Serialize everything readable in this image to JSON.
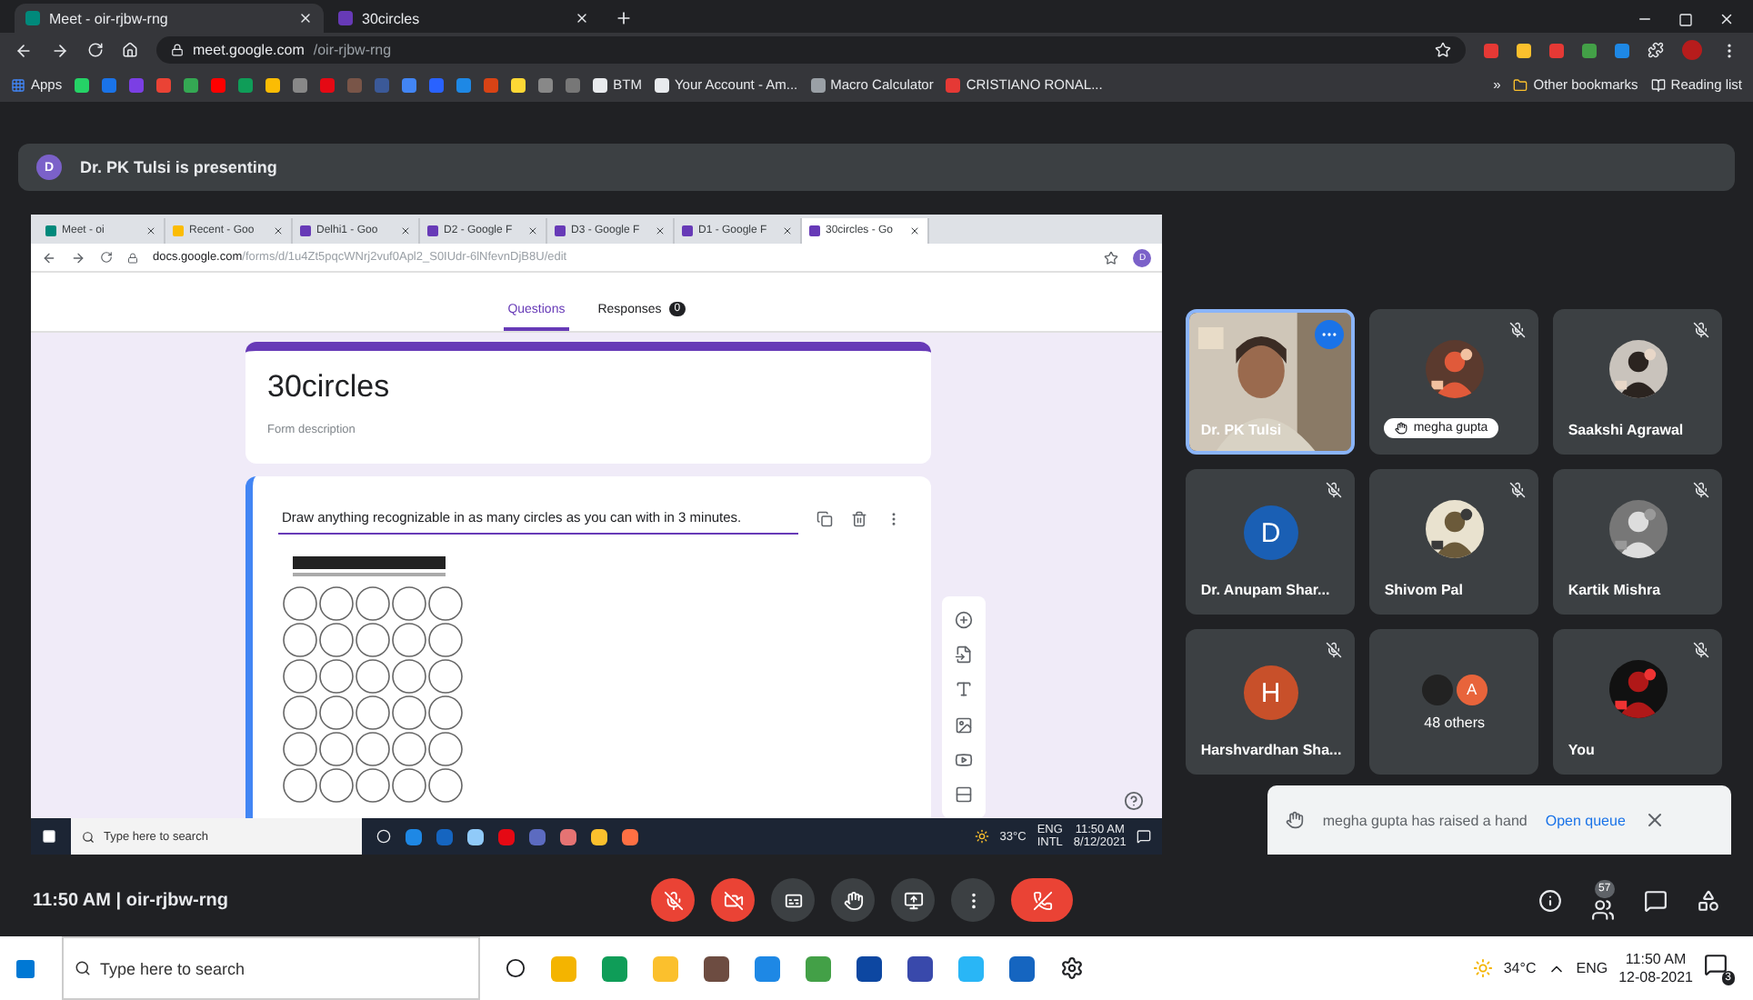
{
  "browser": {
    "tabs": [
      {
        "label": "Meet - oir-rjbw-rng",
        "selected": true
      },
      {
        "label": "30circles",
        "selected": false
      }
    ],
    "url_host": "meet.google.com",
    "url_path": "/oir-rjbw-rng",
    "apps": "Apps",
    "bookmarks": [
      "BTM",
      "Your Account - Am...",
      "Macro Calculator",
      "CRISTIANO RONAL..."
    ],
    "overflow": "»",
    "other_bookmarks": "Other bookmarks",
    "reading_list": "Reading list"
  },
  "presenting": {
    "avatar": "D",
    "text": "Dr. PK Tulsi is presenting"
  },
  "shared_screen": {
    "tabs": [
      {
        "label": "Meet - oi",
        "selected": false
      },
      {
        "label": "Recent - Goo",
        "selected": false
      },
      {
        "label": "Delhi1 - Goo",
        "selected": false
      },
      {
        "label": "D2 - Google F",
        "selected": false
      },
      {
        "label": "D3 - Google F",
        "selected": false
      },
      {
        "label": "D1 - Google F",
        "selected": false
      },
      {
        "label": "30circles - Go",
        "selected": true
      }
    ],
    "url_host": "docs.google.com",
    "url_path": "/forms/d/1u4Zt5pqcWNrj2vuf0Apl2_S0IUdr-6lNfevnDjB8U/edit",
    "profile": "D",
    "form_tabs": [
      {
        "label": "Questions",
        "selected": true
      },
      {
        "label": "Responses",
        "selected": false,
        "count": "0"
      }
    ],
    "form_title": "30circles",
    "form_description": "Form description",
    "question": "Draw anything recognizable in as many circles as you can with in 3 minutes.",
    "taskbar": {
      "search": "Type here to search",
      "temperature": "33°C",
      "lang": "ENG",
      "layout": "INTL",
      "time": "11:50 AM",
      "date": "8/12/2021"
    }
  },
  "participants": [
    {
      "name": "Dr. PK Tulsi",
      "kind": "video",
      "muted": false,
      "speaking": true,
      "hand_raised": false
    },
    {
      "name": "megha gupta",
      "muted": true,
      "speaking": false,
      "hand_raised": true
    },
    {
      "name": "Saakshi Agrawal",
      "muted": true,
      "speaking": false,
      "hand_raised": false
    },
    {
      "name": "Dr. Anupam Shar...",
      "kind": "letter",
      "letter": "D",
      "color": "#1a5fb4",
      "muted": true,
      "speaking": false,
      "hand_raised": false
    },
    {
      "name": "Shivom Pal",
      "muted": true,
      "speaking": false,
      "hand_raised": false
    },
    {
      "name": "Kartik Mishra",
      "muted": true,
      "speaking": false,
      "hand_raised": false
    },
    {
      "name": "Harshvardhan Sha...",
      "kind": "letter",
      "letter": "H",
      "color": "#c8502a",
      "muted": true,
      "speaking": false,
      "hand_raised": false
    },
    {
      "name": "48 others",
      "kind": "others",
      "letter": "A",
      "color": "#e8643b",
      "muted": false,
      "speaking": false,
      "hand_raised": false
    },
    {
      "name": "You",
      "muted": true,
      "speaking": false,
      "hand_raised": false
    }
  ],
  "toast": {
    "text": "megha gupta has raised a hand",
    "action": "Open queue"
  },
  "meeting_bar": {
    "time": "11:50 AM",
    "separator": "|",
    "code": "oir-rjbw-rng",
    "mic_on": false,
    "camera_on": false,
    "people_count": "57"
  },
  "taskbar": {
    "search": "Type here to search",
    "temperature": "34°C",
    "lang": "ENG",
    "time": "11:50 AM",
    "date": "12-08-2021",
    "notifications": "3"
  }
}
